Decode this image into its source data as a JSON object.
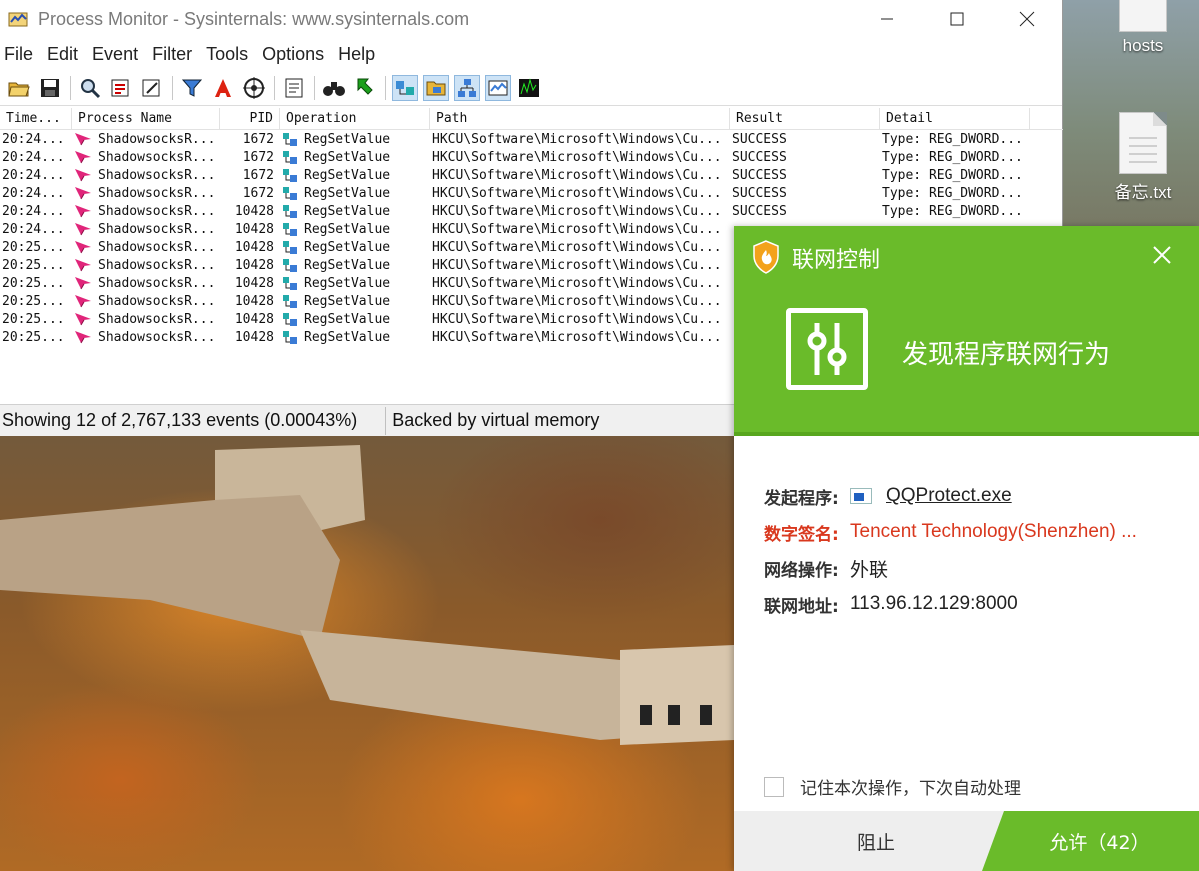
{
  "desktop": {
    "icons": [
      {
        "label": "hosts"
      },
      {
        "label": "备忘.txt"
      }
    ]
  },
  "procmon": {
    "title": "Process Monitor - Sysinternals: www.sysinternals.com",
    "menu": [
      "File",
      "Edit",
      "Event",
      "Filter",
      "Tools",
      "Options",
      "Help"
    ],
    "columns": [
      "Time...",
      "Process Name",
      "PID",
      "Operation",
      "Path",
      "Result",
      "Detail"
    ],
    "rows": [
      {
        "time": "20:24...",
        "process": "ShadowsocksR...",
        "pid": "1672",
        "operation": "RegSetValue",
        "path": "HKCU\\Software\\Microsoft\\Windows\\Cu...",
        "result": "SUCCESS",
        "detail": "Type: REG_DWORD..."
      },
      {
        "time": "20:24...",
        "process": "ShadowsocksR...",
        "pid": "1672",
        "operation": "RegSetValue",
        "path": "HKCU\\Software\\Microsoft\\Windows\\Cu...",
        "result": "SUCCESS",
        "detail": "Type: REG_DWORD..."
      },
      {
        "time": "20:24...",
        "process": "ShadowsocksR...",
        "pid": "1672",
        "operation": "RegSetValue",
        "path": "HKCU\\Software\\Microsoft\\Windows\\Cu...",
        "result": "SUCCESS",
        "detail": "Type: REG_DWORD..."
      },
      {
        "time": "20:24...",
        "process": "ShadowsocksR...",
        "pid": "1672",
        "operation": "RegSetValue",
        "path": "HKCU\\Software\\Microsoft\\Windows\\Cu...",
        "result": "SUCCESS",
        "detail": "Type: REG_DWORD..."
      },
      {
        "time": "20:24...",
        "process": "ShadowsocksR...",
        "pid": "10428",
        "operation": "RegSetValue",
        "path": "HKCU\\Software\\Microsoft\\Windows\\Cu...",
        "result": "SUCCESS",
        "detail": "Type: REG_DWORD..."
      },
      {
        "time": "20:24...",
        "process": "ShadowsocksR...",
        "pid": "10428",
        "operation": "RegSetValue",
        "path": "HKCU\\Software\\Microsoft\\Windows\\Cu...",
        "result": "",
        "detail": ""
      },
      {
        "time": "20:25...",
        "process": "ShadowsocksR...",
        "pid": "10428",
        "operation": "RegSetValue",
        "path": "HKCU\\Software\\Microsoft\\Windows\\Cu...",
        "result": "",
        "detail": ""
      },
      {
        "time": "20:25...",
        "process": "ShadowsocksR...",
        "pid": "10428",
        "operation": "RegSetValue",
        "path": "HKCU\\Software\\Microsoft\\Windows\\Cu...",
        "result": "",
        "detail": ""
      },
      {
        "time": "20:25...",
        "process": "ShadowsocksR...",
        "pid": "10428",
        "operation": "RegSetValue",
        "path": "HKCU\\Software\\Microsoft\\Windows\\Cu...",
        "result": "",
        "detail": ""
      },
      {
        "time": "20:25...",
        "process": "ShadowsocksR...",
        "pid": "10428",
        "operation": "RegSetValue",
        "path": "HKCU\\Software\\Microsoft\\Windows\\Cu...",
        "result": "",
        "detail": ""
      },
      {
        "time": "20:25...",
        "process": "ShadowsocksR...",
        "pid": "10428",
        "operation": "RegSetValue",
        "path": "HKCU\\Software\\Microsoft\\Windows\\Cu...",
        "result": "",
        "detail": ""
      },
      {
        "time": "20:25...",
        "process": "ShadowsocksR...",
        "pid": "10428",
        "operation": "RegSetValue",
        "path": "HKCU\\Software\\Microsoft\\Windows\\Cu...",
        "result": "",
        "detail": ""
      }
    ],
    "status": {
      "events": "Showing 12 of 2,767,133 events (0.00043%)",
      "memory": "Backed by virtual memory"
    }
  },
  "popup": {
    "title": "联网控制",
    "headline": "发现程序联网行为",
    "accent_color": "#6abb2a",
    "warning_color": "#d9381e",
    "details": {
      "program_label": "发起程序:",
      "program_value": "QQProtect.exe",
      "signature_label": "数字签名:",
      "signature_value": "Tencent Technology(Shenzhen) ...",
      "operation_label": "网络操作:",
      "operation_value": "外联",
      "address_label": "联网地址:",
      "address_value": "113.96.12.129:8000"
    },
    "remember_label": "记住本次操作，下次自动处理",
    "block_label": "阻止",
    "allow_label": "允许（42）"
  }
}
